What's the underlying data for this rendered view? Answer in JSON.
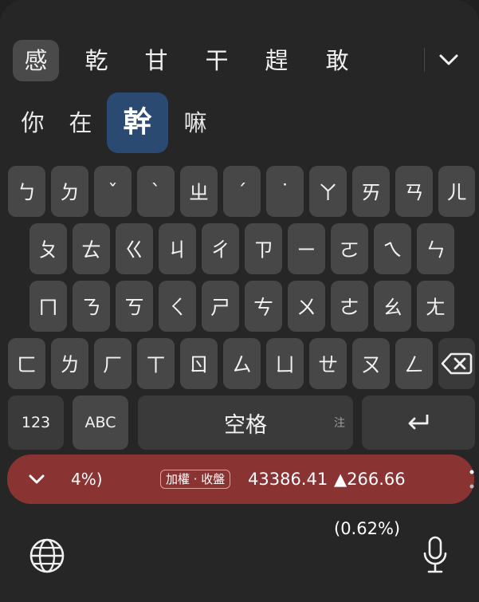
{
  "candidates": [
    "感",
    "乾",
    "甘",
    "干",
    "趕",
    "敢"
  ],
  "composing": {
    "before": [
      "你",
      "在"
    ],
    "highlight": "幹",
    "after": [
      "嘛"
    ]
  },
  "rows": [
    [
      "ㄅ",
      "ㄉ",
      "ˇ",
      "ˋ",
      "ㄓ",
      "ˊ",
      "˙",
      "ㄚ",
      "ㄞ",
      "ㄢ",
      "ㄦ"
    ],
    [
      "ㄆ",
      "ㄊ",
      "ㄍ",
      "ㄐ",
      "ㄔ",
      "ㄗ",
      "ㄧ",
      "ㄛ",
      "ㄟ",
      "ㄣ"
    ],
    [
      "ㄇ",
      "ㄋ",
      "ㄎ",
      "ㄑ",
      "ㄕ",
      "ㄘ",
      "ㄨ",
      "ㄜ",
      "ㄠ",
      "ㄤ"
    ],
    [
      "ㄈ",
      "ㄌ",
      "ㄏ",
      "ㄒ",
      "ㄖ",
      "ㄙ",
      "ㄩ",
      "ㄝ",
      "ㄡ",
      "ㄥ"
    ]
  ],
  "bottom_row": {
    "numbers": "123",
    "abc": "ABC",
    "space": "空格",
    "space_sub": "注"
  },
  "icons": {
    "backspace": "backspace-icon",
    "enter": "enter-icon",
    "globe": "globe-icon",
    "mic": "microphone-icon",
    "collapse": "chevron-down-icon"
  },
  "ticker": {
    "pct": "4%)",
    "badge": "加權 · 收盤",
    "value": "43386.41",
    "change": "▲266.66 (0.62%)"
  },
  "colors": {
    "ticker_bg": "#8a3333",
    "highlight_bg": "#2b4a72",
    "key_bg": "#474747"
  }
}
